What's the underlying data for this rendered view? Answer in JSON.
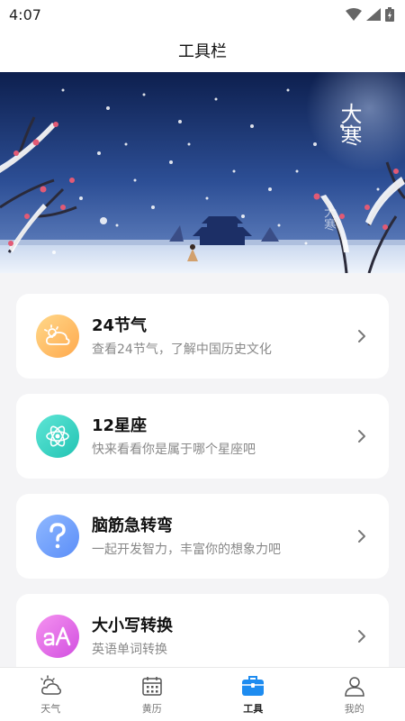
{
  "status_bar": {
    "time": "4:07"
  },
  "header": {
    "title": "工具栏"
  },
  "banner": {
    "caption_big": "大寒",
    "caption_small": "大寒"
  },
  "tools": [
    {
      "title": "24节气",
      "desc": "查看24节气，了解中国历史文化",
      "icon": "weather-cloud-icon",
      "color_from": "#ffd88a",
      "color_to": "#ffa94d"
    },
    {
      "title": "12星座",
      "desc": "快来看看你是属于哪个星座吧",
      "icon": "atom-icon",
      "color_from": "#5ee6d6",
      "color_to": "#22c3b3"
    },
    {
      "title": "脑筋急转弯",
      "desc": "一起开发智力，丰富你的想象力吧",
      "icon": "question-icon",
      "color_from": "#8fb8ff",
      "color_to": "#5b8ef8"
    },
    {
      "title": "大小写转换",
      "desc": "英语单词转换",
      "icon": "letter-case-icon",
      "color_from": "#f593f0",
      "color_to": "#d24fe0"
    }
  ],
  "tabs": [
    {
      "label": "天气",
      "icon": "weather-icon",
      "active": false
    },
    {
      "label": "黄历",
      "icon": "calendar-icon",
      "active": false
    },
    {
      "label": "工具",
      "icon": "toolbox-icon",
      "active": true
    },
    {
      "label": "我的",
      "icon": "person-icon",
      "active": false
    }
  ],
  "colors": {
    "accent": "#1e8cf0",
    "background": "#f4f4f6"
  }
}
